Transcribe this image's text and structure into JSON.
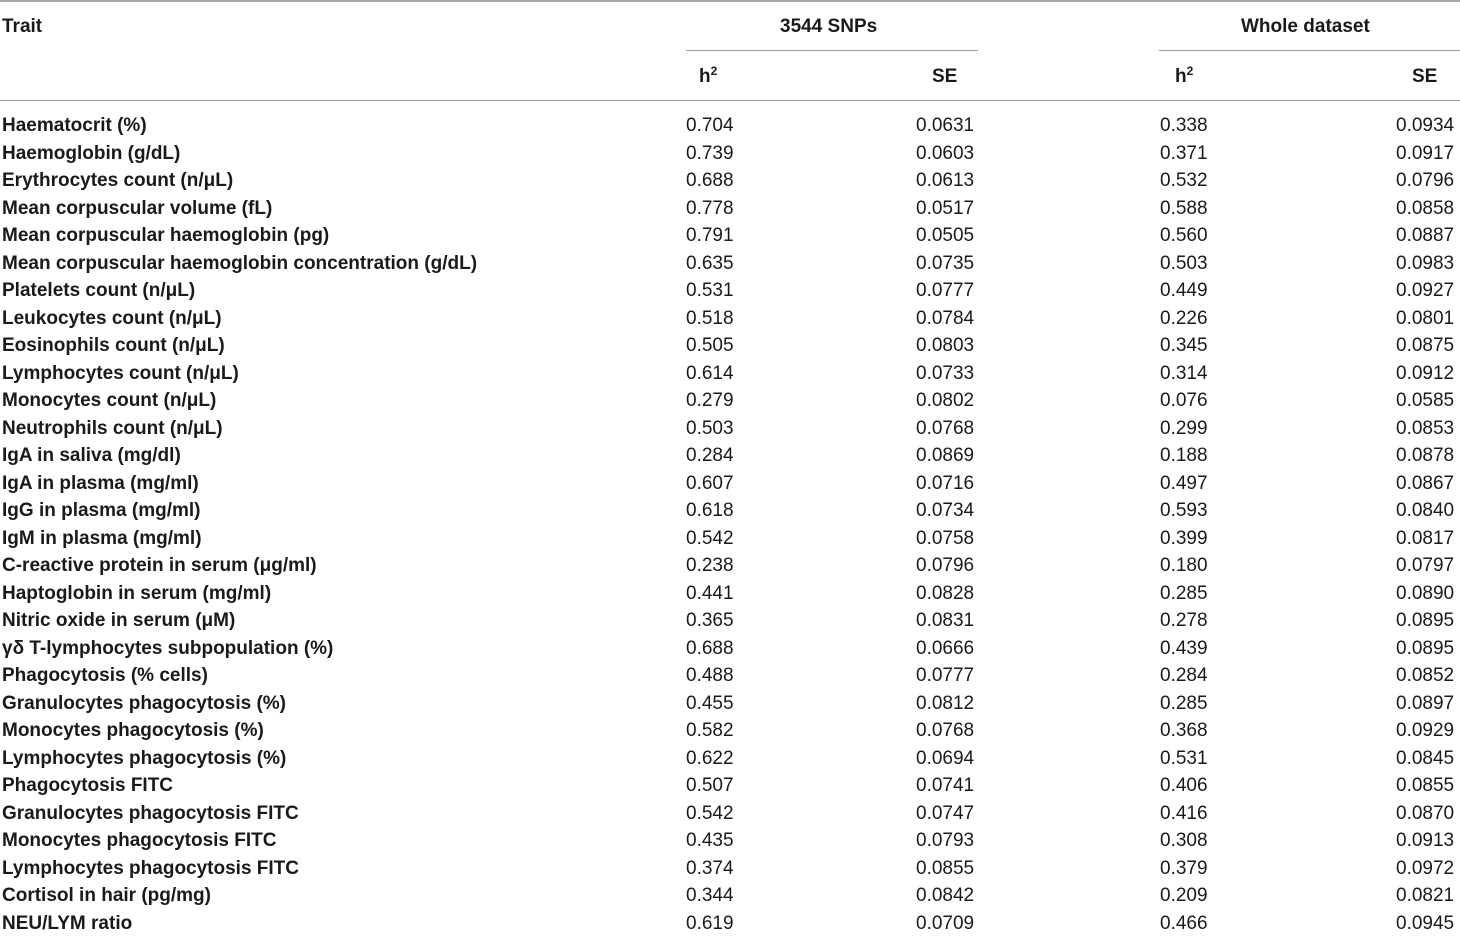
{
  "headers": {
    "trait": "Trait",
    "group1": "3544 SNPs",
    "group2": "Whole dataset",
    "h2_base": "h",
    "h2_sup": "2",
    "se": "SE"
  },
  "rows": [
    {
      "trait": "Haematocrit (%)",
      "h2_snp": "0.704",
      "se_snp": "0.0631",
      "h2_all": "0.338",
      "se_all": "0.0934"
    },
    {
      "trait": "Haemoglobin (g/dL)",
      "h2_snp": "0.739",
      "se_snp": "0.0603",
      "h2_all": "0.371",
      "se_all": "0.0917"
    },
    {
      "trait": "Erythrocytes count (n/μL)",
      "h2_snp": "0.688",
      "se_snp": "0.0613",
      "h2_all": "0.532",
      "se_all": "0.0796"
    },
    {
      "trait": "Mean corpuscular volume (fL)",
      "h2_snp": "0.778",
      "se_snp": "0.0517",
      "h2_all": "0.588",
      "se_all": "0.0858"
    },
    {
      "trait": "Mean corpuscular haemoglobin (pg)",
      "h2_snp": "0.791",
      "se_snp": "0.0505",
      "h2_all": "0.560",
      "se_all": "0.0887"
    },
    {
      "trait": "Mean corpuscular haemoglobin concentration (g/dL)",
      "h2_snp": "0.635",
      "se_snp": "0.0735",
      "h2_all": "0.503",
      "se_all": "0.0983"
    },
    {
      "trait": "Platelets count (n/μL)",
      "h2_snp": "0.531",
      "se_snp": "0.0777",
      "h2_all": "0.449",
      "se_all": "0.0927"
    },
    {
      "trait": "Leukocytes count (n/μL)",
      "h2_snp": "0.518",
      "se_snp": "0.0784",
      "h2_all": "0.226",
      "se_all": "0.0801"
    },
    {
      "trait": "Eosinophils count (n/μL)",
      "h2_snp": "0.505",
      "se_snp": "0.0803",
      "h2_all": "0.345",
      "se_all": "0.0875"
    },
    {
      "trait": "Lymphocytes count (n/μL)",
      "h2_snp": "0.614",
      "se_snp": "0.0733",
      "h2_all": "0.314",
      "se_all": "0.0912"
    },
    {
      "trait": "Monocytes count (n/μL)",
      "h2_snp": "0.279",
      "se_snp": "0.0802",
      "h2_all": "0.076",
      "se_all": "0.0585"
    },
    {
      "trait": "Neutrophils count (n/μL)",
      "h2_snp": "0.503",
      "se_snp": "0.0768",
      "h2_all": "0.299",
      "se_all": "0.0853"
    },
    {
      "trait": "IgA in saliva (mg/dl)",
      "h2_snp": "0.284",
      "se_snp": "0.0869",
      "h2_all": "0.188",
      "se_all": "0.0878"
    },
    {
      "trait": "IgA in plasma (mg/ml)",
      "h2_snp": "0.607",
      "se_snp": "0.0716",
      "h2_all": "0.497",
      "se_all": "0.0867"
    },
    {
      "trait": "IgG in plasma (mg/ml)",
      "h2_snp": "0.618",
      "se_snp": "0.0734",
      "h2_all": "0.593",
      "se_all": "0.0840"
    },
    {
      "trait": "IgM in plasma (mg/ml)",
      "h2_snp": "0.542",
      "se_snp": "0.0758",
      "h2_all": "0.399",
      "se_all": "0.0817"
    },
    {
      "trait": "C-reactive protein in serum (μg/ml)",
      "h2_snp": "0.238",
      "se_snp": "0.0796",
      "h2_all": "0.180",
      "se_all": "0.0797"
    },
    {
      "trait": "Haptoglobin in serum (mg/ml)",
      "h2_snp": "0.441",
      "se_snp": "0.0828",
      "h2_all": "0.285",
      "se_all": "0.0890"
    },
    {
      "trait": "Nitric oxide in serum (μM)",
      "h2_snp": "0.365",
      "se_snp": "0.0831",
      "h2_all": "0.278",
      "se_all": "0.0895"
    },
    {
      "trait": "γδ T-lymphocytes subpopulation (%)",
      "h2_snp": "0.688",
      "se_snp": "0.0666",
      "h2_all": "0.439",
      "se_all": "0.0895"
    },
    {
      "trait": "Phagocytosis (% cells)",
      "h2_snp": "0.488",
      "se_snp": "0.0777",
      "h2_all": "0.284",
      "se_all": "0.0852"
    },
    {
      "trait": "Granulocytes phagocytosis (%)",
      "h2_snp": "0.455",
      "se_snp": "0.0812",
      "h2_all": "0.285",
      "se_all": "0.0897"
    },
    {
      "trait": "Monocytes phagocytosis (%)",
      "h2_snp": "0.582",
      "se_snp": "0.0768",
      "h2_all": "0.368",
      "se_all": "0.0929"
    },
    {
      "trait": "Lymphocytes phagocytosis (%)",
      "h2_snp": "0.622",
      "se_snp": "0.0694",
      "h2_all": "0.531",
      "se_all": "0.0845"
    },
    {
      "trait": "Phagocytosis FITC",
      "h2_snp": "0.507",
      "se_snp": "0.0741",
      "h2_all": "0.406",
      "se_all": "0.0855"
    },
    {
      "trait": "Granulocytes phagocytosis FITC",
      "h2_snp": "0.542",
      "se_snp": "0.0747",
      "h2_all": "0.416",
      "se_all": "0.0870"
    },
    {
      "trait": "Monocytes phagocytosis FITC",
      "h2_snp": "0.435",
      "se_snp": "0.0793",
      "h2_all": "0.308",
      "se_all": "0.0913"
    },
    {
      "trait": "Lymphocytes phagocytosis FITC",
      "h2_snp": "0.374",
      "se_snp": "0.0855",
      "h2_all": "0.379",
      "se_all": "0.0972"
    },
    {
      "trait": "Cortisol in hair (pg/mg)",
      "h2_snp": "0.344",
      "se_snp": "0.0842",
      "h2_all": "0.209",
      "se_all": "0.0821"
    },
    {
      "trait": "NEU/LYM ratio",
      "h2_snp": "0.619",
      "se_snp": "0.0709",
      "h2_all": "0.466",
      "se_all": "0.0945"
    }
  ]
}
